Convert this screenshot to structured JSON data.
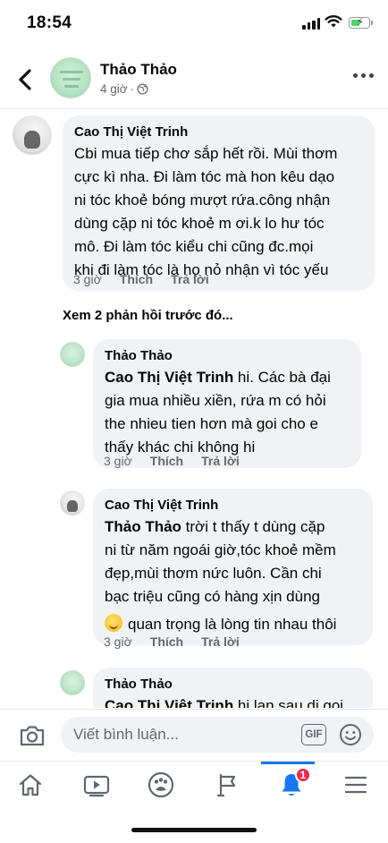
{
  "status_bar": {
    "time": "18:54"
  },
  "post": {
    "author": "Thảo Thảo",
    "time": "4 giờ",
    "privacy_icon": "globe-icon"
  },
  "comments": [
    {
      "author": "Cao Thị Việt Trinh",
      "lines": [
        "Cbi mua tiếp chơ sắp hết rồi. Mùi thơm",
        "cực kì nha. Đi làm tóc mà hon kêu dạo",
        "ni tóc khoẻ bóng mượt rứa.công nhận",
        "dùng cặp ni tóc khoẻ m ơi.k lo hư tóc",
        "mô. Đi làm tóc kiểu chi cũng đc.mọi",
        "khi đi làm tóc là họ nỏ nhận vì tóc yếu"
      ],
      "time": "3 giờ",
      "like": "Thích",
      "reply": "Trả lời"
    }
  ],
  "view_previous": "Xem 2 phản hồi trước đó...",
  "replies": [
    {
      "author": "Thảo Thảo",
      "mention": "Cao Thị Việt Trinh",
      "first_rest": " hi. Các bà đại",
      "lines": [
        "gia mua nhiều xiền, rứa m có hỏi",
        "the nhieu tien hơn mà goi cho e",
        "thấy khác chi không hi"
      ],
      "time": "3 giờ",
      "like": "Thích",
      "reply": "Trả lời"
    },
    {
      "author": "Cao Thị Việt Trinh",
      "mention": "Thảo Thảo",
      "first_rest": " trời t thấy t dùng cặp",
      "lines": [
        "ni từ năm ngoái giờ,tóc khoẻ mềm",
        "đẹp,mùi thơm nức luôn. Cần chi",
        "bạc triệu cũng có hàng xịn dùng"
      ],
      "emoji_line": "quan trọng là lòng tin nhau thôi",
      "time": "3 giờ",
      "like": "Thích",
      "reply": "Trả lời"
    },
    {
      "author": "Thảo Thảo",
      "mention": "Cao Thị Việt Trinh",
      "first_rest": " hi lan sau di goi"
    }
  ],
  "composer": {
    "placeholder": "Viết bình luận...",
    "gif_label": "GIF"
  },
  "tabs": {
    "items": [
      "home-icon",
      "watch-icon",
      "groups-icon",
      "pages-flag-icon",
      "notifications-bell-icon",
      "menu-icon"
    ],
    "notification_count": "1",
    "active_color": "#1877f2"
  }
}
